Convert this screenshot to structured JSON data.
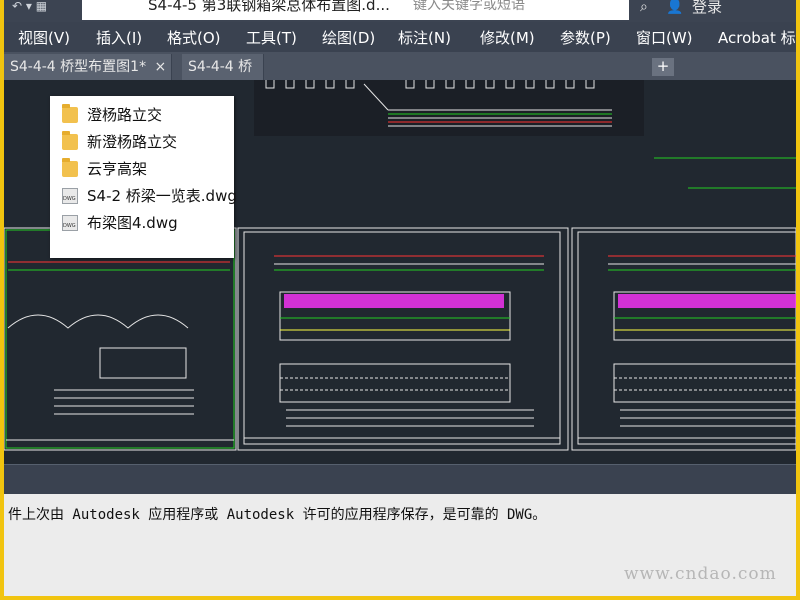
{
  "window": {
    "title": "S4-4-5 第3联钢箱梁总体布置图.d...",
    "quick_access": "↶ ▾  ▦",
    "search_placeholder": "键入关键字或短语",
    "login_label": "登录",
    "binoculars_icon": "binoculars-icon",
    "user_icon": "user-icon"
  },
  "menu": {
    "items": [
      {
        "label": "视图(V)"
      },
      {
        "label": "插入(I)"
      },
      {
        "label": "格式(O)"
      },
      {
        "label": "工具(T)"
      },
      {
        "label": "绘图(D)"
      },
      {
        "label": "标注(N)"
      },
      {
        "label": "修改(M)"
      },
      {
        "label": "参数(P)"
      },
      {
        "label": "窗口(W)"
      },
      {
        "label": "Acrobat 标"
      }
    ]
  },
  "tabs": {
    "items": [
      {
        "label": "S4-4-4 桥型布置图1*"
      },
      {
        "label": "S4-4-4 桥"
      }
    ],
    "close_glyph": "×",
    "add_glyph": "+"
  },
  "recent_files": {
    "items": [
      {
        "label": "澄杨路立交",
        "icon": "folder-icon"
      },
      {
        "label": "新澄杨路立交",
        "icon": "folder-icon"
      },
      {
        "label": "云亨高架",
        "icon": "folder-icon"
      },
      {
        "label": "S4-2 桥梁一览表.dwg",
        "icon": "dwg-file-icon"
      },
      {
        "label": "布梁图4.dwg",
        "icon": "dwg-file-icon"
      }
    ]
  },
  "status": {
    "message": "件上次由 Autodesk 应用程序或 Autodesk 许可的应用程序保存，是可靠的 DWG。"
  },
  "watermark": "www.cndao.com",
  "colors": {
    "frame_border": "#f1c40f",
    "canvas_bg": "#212830",
    "drawing_green": "#22cc22",
    "drawing_red": "#ff3333",
    "drawing_magenta": "#ff33ff",
    "drawing_white": "#e6e6e6",
    "drawing_yellow": "#ffff44"
  }
}
